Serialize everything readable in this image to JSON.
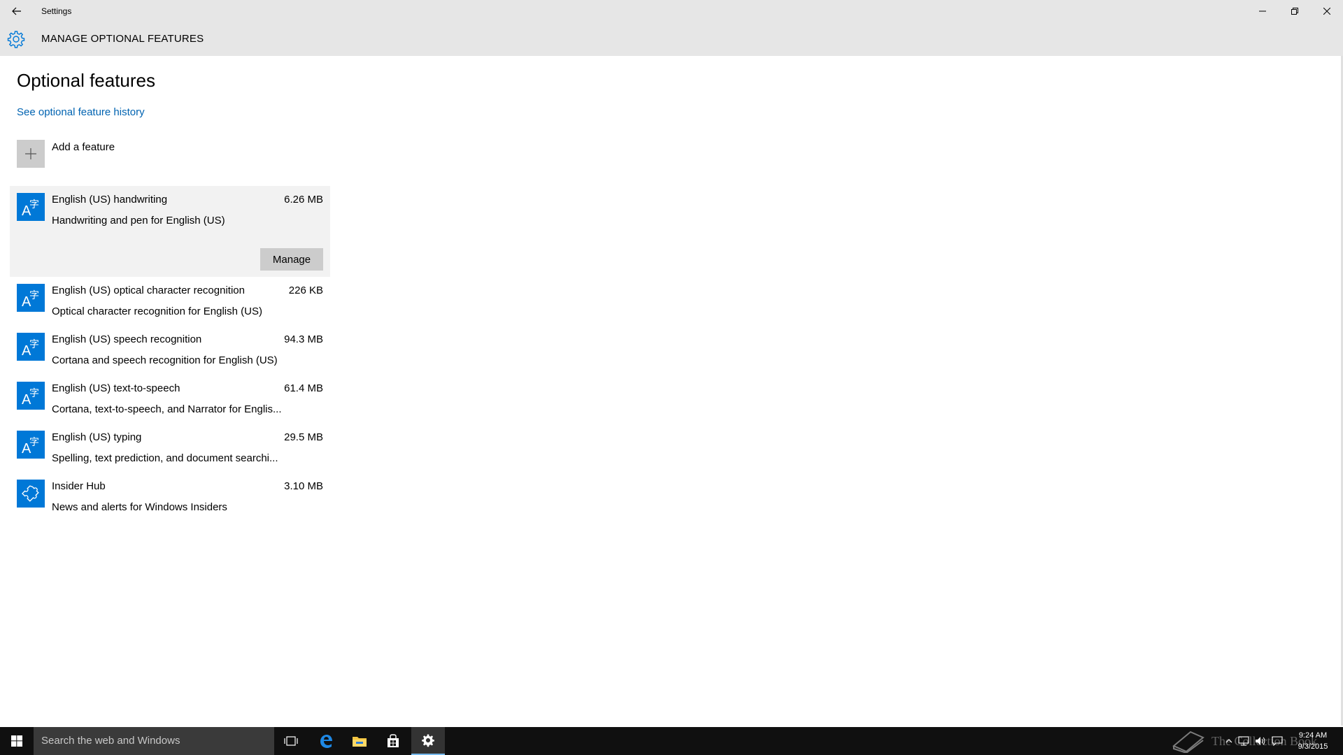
{
  "window": {
    "app_title": "Settings"
  },
  "header": {
    "title": "MANAGE OPTIONAL FEATURES"
  },
  "main": {
    "title": "Optional features",
    "history_link": "See optional feature history",
    "add_feature_label": "Add a feature",
    "features": [
      {
        "name": "English (US) handwriting",
        "size": "6.26 MB",
        "description": "Handwriting and pen for English (US)",
        "icon": "language-icon",
        "selected": true,
        "manage_label": "Manage"
      },
      {
        "name": "English (US) optical character recognition",
        "size": "226 KB",
        "description": "Optical character recognition for English (US)",
        "icon": "language-icon"
      },
      {
        "name": "English (US) speech recognition",
        "size": "94.3 MB",
        "description": "Cortana and speech recognition for English (US)",
        "icon": "language-icon"
      },
      {
        "name": "English (US) text-to-speech",
        "size": "61.4 MB",
        "description": "Cortana, text-to-speech, and Narrator for Englis...",
        "icon": "language-icon"
      },
      {
        "name": "English (US) typing",
        "size": "29.5 MB",
        "description": "Spelling, text prediction, and document searchi...",
        "icon": "language-icon"
      },
      {
        "name": "Insider Hub",
        "size": "3.10 MB",
        "description": "News and alerts for Windows Insiders",
        "icon": "puzzle-icon"
      }
    ]
  },
  "taskbar": {
    "search_placeholder": "Search the web and Windows",
    "clock_time": "9:24 AM",
    "clock_date": "9/3/2015",
    "watermark_text": "The Collection Book"
  },
  "colors": {
    "accent": "#0078d7",
    "link": "#0063b1",
    "chrome": "#e6e6e6",
    "taskbar": "#101010"
  }
}
